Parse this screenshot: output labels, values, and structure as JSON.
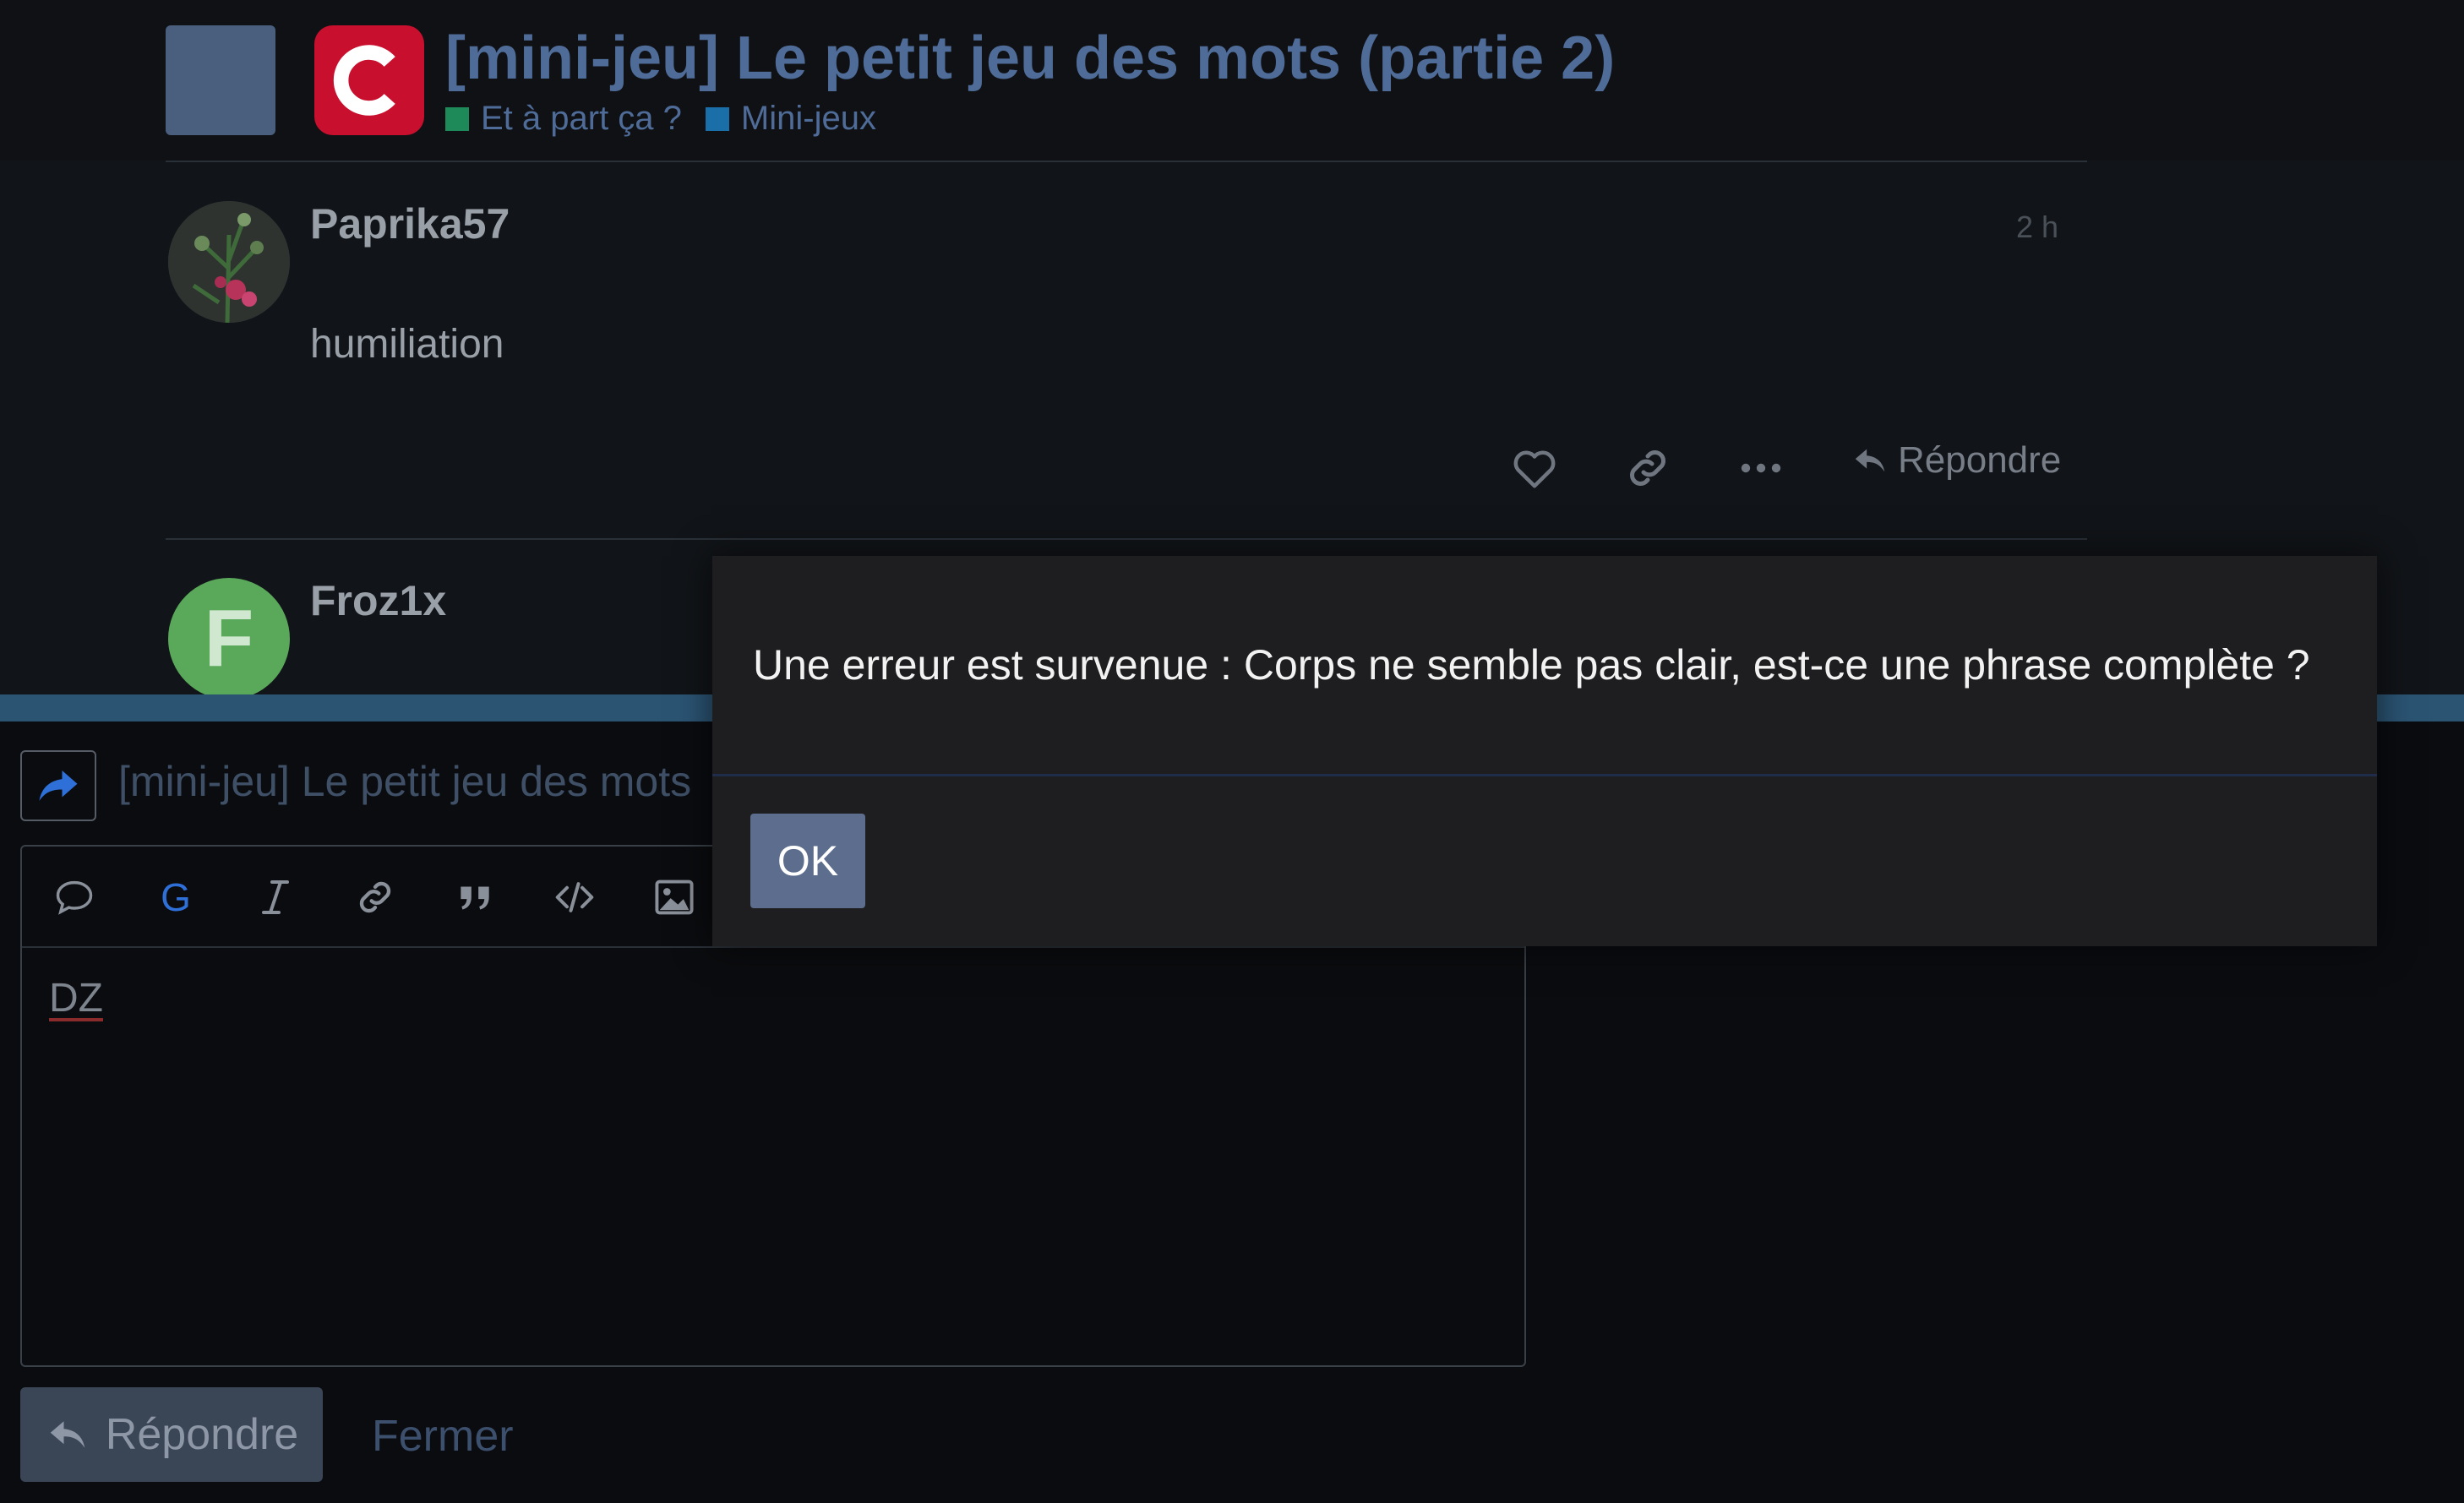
{
  "header": {
    "topic_title": "[mini-jeu] Le petit jeu des mots (partie 2)",
    "categories": [
      {
        "label": "Et à part ça ?",
        "color": "#1e8a5a"
      },
      {
        "label": "Mini-jeux",
        "color": "#1b6fa8"
      }
    ],
    "logo_color": "#c8102e"
  },
  "posts": [
    {
      "username": "Paprika57",
      "time": "2 h",
      "body": "humiliation",
      "reply_label": "Répondre"
    },
    {
      "username": "Froz1x",
      "avatar_letter": "F",
      "avatar_color": "#5aa85a"
    }
  ],
  "composer": {
    "title": "[mini-jeu] Le petit jeu des mots",
    "editor_text": "DZ",
    "reply_button": "Répondre",
    "close_button": "Fermer",
    "toolbar_icons": [
      "speech-bubble-icon",
      "bold-icon",
      "italic-icon",
      "link-icon",
      "quote-icon",
      "code-icon",
      "image-icon"
    ],
    "bold_glyph": "G"
  },
  "modal": {
    "message": "Une erreur est survenue : Corps ne semble pas clair, est-ce une phrase complète ?",
    "ok_label": "OK"
  }
}
